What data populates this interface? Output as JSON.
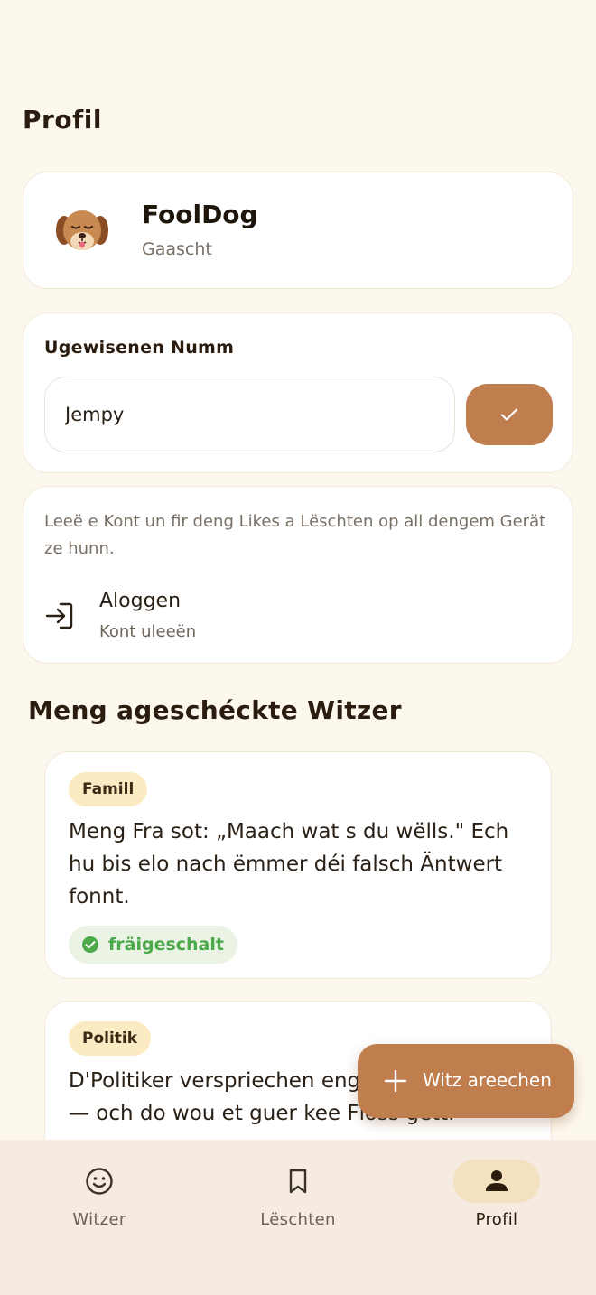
{
  "header": {
    "title": "Profil"
  },
  "profile": {
    "name": "FoolDog",
    "role": "Gaascht"
  },
  "assigned_name": {
    "label": "Ugewisenen Numm",
    "value": "Jempy"
  },
  "login": {
    "info": "Leeë e Kont un fir deng Likes a Lëschten op all dengem Gerät ze hunn.",
    "title": "Aloggen",
    "subtitle": "Kont uleeën"
  },
  "jokes_section": {
    "title": "Meng ageschéckte Witzer",
    "items": [
      {
        "category": "Famill",
        "text": "Meng Fra sot: „Maach wat s du wëlls.\" Ech hu bis elo nach ëmmer déi falsch Äntwert fonnt.",
        "status": "fräigeschalt"
      },
      {
        "category": "Politik",
        "text": "D'Politiker verspriechen eng Bréck ze bauen — och do wou et guer kee Floss gëtt."
      }
    ]
  },
  "fab": {
    "label": "Witz areechen"
  },
  "nav": {
    "items": [
      {
        "label": "Witzer",
        "icon": "smiley-icon"
      },
      {
        "label": "Lëschten",
        "icon": "bookmark-icon"
      },
      {
        "label": "Profil",
        "icon": "person-icon"
      }
    ],
    "active": "Profil"
  },
  "colors": {
    "accent": "#c07d4e",
    "background": "#fdf8ee",
    "success": "#4caa4a",
    "tag": "#fcebc2"
  }
}
